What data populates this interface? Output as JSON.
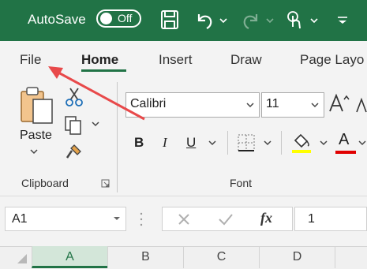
{
  "titlebar": {
    "autosave_label": "AutoSave",
    "autosave_state": "Off",
    "icons": [
      "save-icon",
      "undo-icon",
      "redo-icon",
      "touch-mode-icon",
      "customize-qat-icon"
    ]
  },
  "ribbon_tabs": [
    "File",
    "Home",
    "Insert",
    "Draw",
    "Page Layo"
  ],
  "active_tab": "Home",
  "clipboard": {
    "paste_label": "Paste",
    "group_label": "Clipboard"
  },
  "font": {
    "font_name": "Calibri",
    "font_size": "11",
    "bold": "B",
    "italic": "I",
    "underline": "U",
    "font_color_letter": "A",
    "group_label": "Font"
  },
  "formula_bar": {
    "name_box": "A1",
    "fx_label": "fx",
    "value": "1"
  },
  "columns": [
    "A",
    "B",
    "C",
    "D"
  ],
  "colors": {
    "brand": "#217346",
    "highlight": "#ffff00",
    "font_color": "#e00000",
    "annotation_arrow": "#e8494a"
  }
}
